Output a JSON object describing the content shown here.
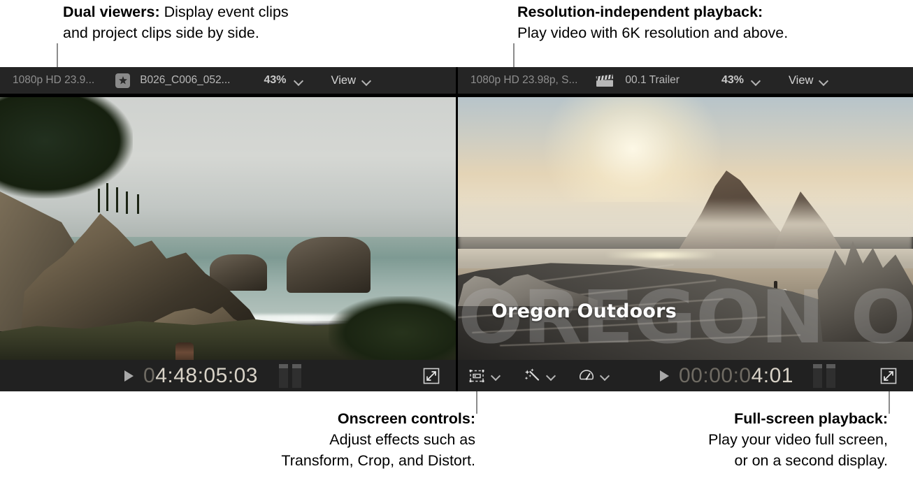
{
  "callouts": {
    "dual_viewers": {
      "title": "Dual viewers:",
      "line1_rest": " Display event clips",
      "line2": "and project clips side by side."
    },
    "resolution": {
      "title": "Resolution-independent playback:",
      "line2": "Play video with 6K resolution and above."
    },
    "onscreen": {
      "title": "Onscreen controls:",
      "line2": "Adjust effects such as",
      "line3": "Transform, Crop, and Distort."
    },
    "fullscreen": {
      "title": "Full-screen playback:",
      "line2": "Play your video full screen,",
      "line3": "or on a second display."
    }
  },
  "event_viewer": {
    "toolbar": {
      "format_info": "1080p HD 23.9...",
      "favorite_icon": "star-icon",
      "clip_name": "B026_C006_052...",
      "zoom_level": "43%",
      "zoom_chevron": "chevron-down-icon",
      "view_label": "View",
      "view_chevron": "chevron-down-icon"
    },
    "transport": {
      "play_icon": "play-triangle-icon",
      "timecode_dim": "0",
      "timecode_bright": "4:48:05:03",
      "expand_icon": "expand-diagonal-icon"
    }
  },
  "project_viewer": {
    "toolbar": {
      "format_info": "1080p HD 23.98p, S...",
      "project_icon": "clapperboard-icon",
      "project_name": "00.1 Trailer",
      "zoom_level": "43%",
      "zoom_chevron": "chevron-down-icon",
      "view_label": "View",
      "view_chevron": "chevron-down-icon"
    },
    "onscreen_controls": [
      {
        "icon": "transform-crop-icon",
        "chevron": "chevron-down-icon"
      },
      {
        "icon": "effects-wand-icon",
        "chevron": "chevron-down-icon"
      },
      {
        "icon": "retime-speedometer-icon",
        "chevron": "chevron-down-icon"
      }
    ],
    "transport": {
      "play_icon": "play-triangle-icon",
      "timecode_dim": "00:00:0",
      "timecode_bright": "4:01",
      "expand_icon": "expand-diagonal-icon"
    },
    "video_overlay": {
      "background_title": "OREGON OUTDOORS",
      "foreground_title": "Oregon Outdoors"
    }
  },
  "colors": {
    "page_background": "#ffffff",
    "toolbar_background": "#252525",
    "transport_background": "#212121",
    "window_background": "#1d1d1d",
    "text_primary": "#d5d5d5",
    "text_secondary": "#8e8e8e",
    "timecode_bright": "#d8d2c7",
    "timecode_dim": "#6f6b63",
    "leader_line": "#8c8c8c"
  }
}
